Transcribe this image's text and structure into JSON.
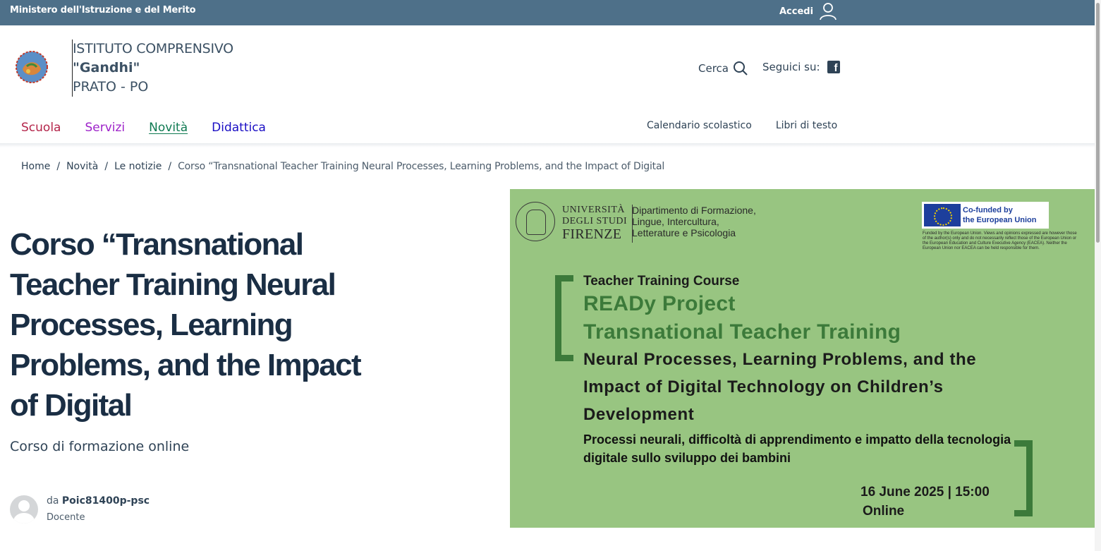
{
  "topbar": {
    "ministry": "Ministero dell'Istruzione e del Merito",
    "login_label": "Accedi"
  },
  "header": {
    "school_line1": "ISTITUTO COMPRENSIVO",
    "school_line2": "\"Gandhi\"",
    "school_line3": "PRATO - PO",
    "search_label": "Cerca",
    "social_label": "Seguici su:",
    "logo_text": "IL FUTURO È NELLE NOSTRE MANI"
  },
  "nav": {
    "items": [
      "Scuola",
      "Servizi",
      "Novità",
      "Didattica"
    ],
    "secondary": [
      "Calendario scolastico",
      "Libri di testo"
    ]
  },
  "breadcrumb": {
    "home": "Home",
    "section": "Novità",
    "subsection": "Le notizie",
    "current": "Corso “Transnational Teacher Training Neural Processes, Learning Problems, and the Impact of Digital",
    "separator": "/"
  },
  "article": {
    "title": "Corso “Transnational Teacher Training Neural Processes, Learning Problems, and the Impact of Digital",
    "subtitle": "Corso di formazione online",
    "author_prefix": "da",
    "author_name": "Poic81400p-psc",
    "author_role": "Docente"
  },
  "poster": {
    "university_line1": "UNIVERSITÀ",
    "university_line2": "DEGLI STUDI",
    "university_line3": "FIRENZE",
    "department": [
      "Dipartimento di Formazione,",
      "Lingue, Intercultura,",
      "Letterature e Psicologia"
    ],
    "eu_badge": [
      "Co-funded by",
      "the European Union"
    ],
    "eu_disclaimer": "Funded by the European Union. Views and opinions expressed are however those of the author(s) only and do not necessarily reflect those of the European Union or the European Education and Culture Executive Agency (EACEA). Neither the European Union nor EACEA can be held responsible for them.",
    "course_label": "Teacher Training Course",
    "project_line1": "READy Project",
    "project_line2": "Transnational Teacher Training",
    "english_title": "Neural Processes, Learning Problems, and the Impact of Digital Technology on Children’s Development",
    "italian_title": "Processi neurali, difficoltà di apprendimento e impatto della tecnologia digitale sullo sviluppo dei bambini",
    "date_time": "16 June 2025 |  15:00",
    "mode": "Online",
    "colors": {
      "background": "#98c581",
      "accent": "#3c7a3a"
    }
  },
  "colors": {
    "topbar": "#4e7089",
    "nav_scuola": "#b4254a",
    "nav_servizi": "#9d22c9",
    "nav_novita": "#0f7a52",
    "nav_didattica": "#1a0ec4"
  }
}
